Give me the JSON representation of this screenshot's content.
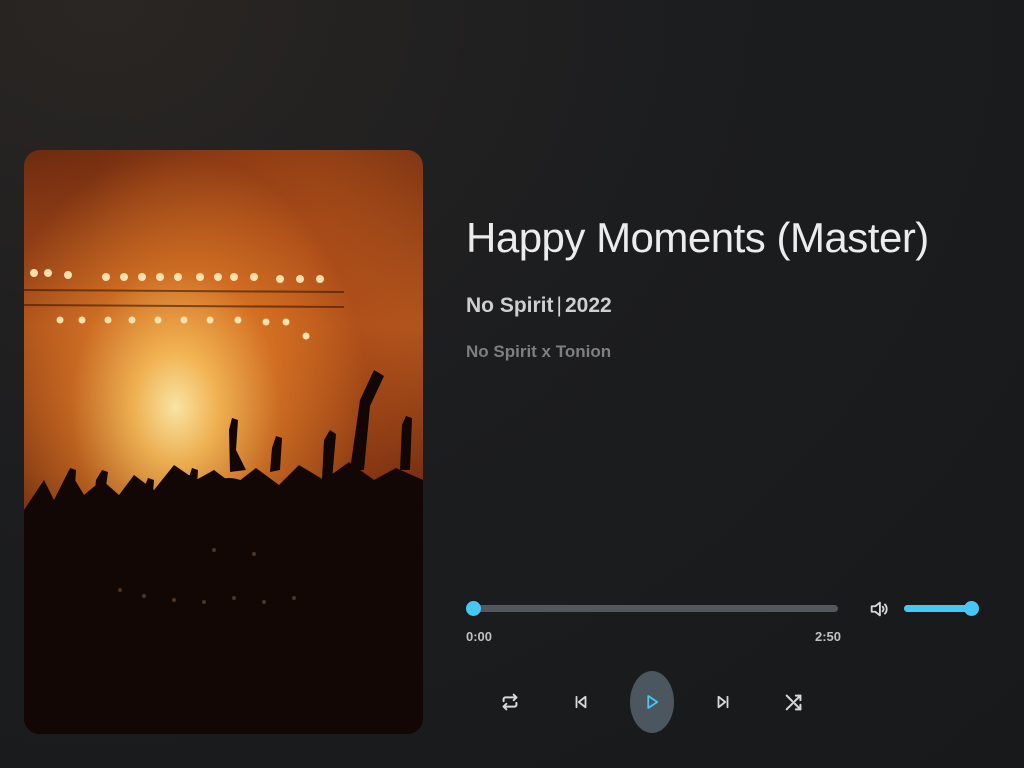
{
  "track": {
    "title": "Happy Moments (Master)",
    "artist": "No Spirit",
    "separator": "|",
    "year": "2022",
    "credits": "No Spirit x Tonion"
  },
  "album_art": {
    "icon": "concert-crowd-image"
  },
  "playback": {
    "current_time": "0:00",
    "total_time": "2:50",
    "progress_fraction": 0.0,
    "is_playing": false
  },
  "volume": {
    "icon": "volume-icon",
    "level_fraction": 1.0
  },
  "controls": {
    "repeat_icon": "repeat-icon",
    "previous_icon": "skip-previous-icon",
    "play_icon": "play-icon",
    "next_icon": "skip-next-icon",
    "shuffle_icon": "shuffle-icon"
  },
  "colors": {
    "accent": "#46c8f5",
    "track": "#52585d",
    "background": "#1c1d1f",
    "play_button_bg": "#4b565e",
    "icon": "#d9d9d9"
  }
}
